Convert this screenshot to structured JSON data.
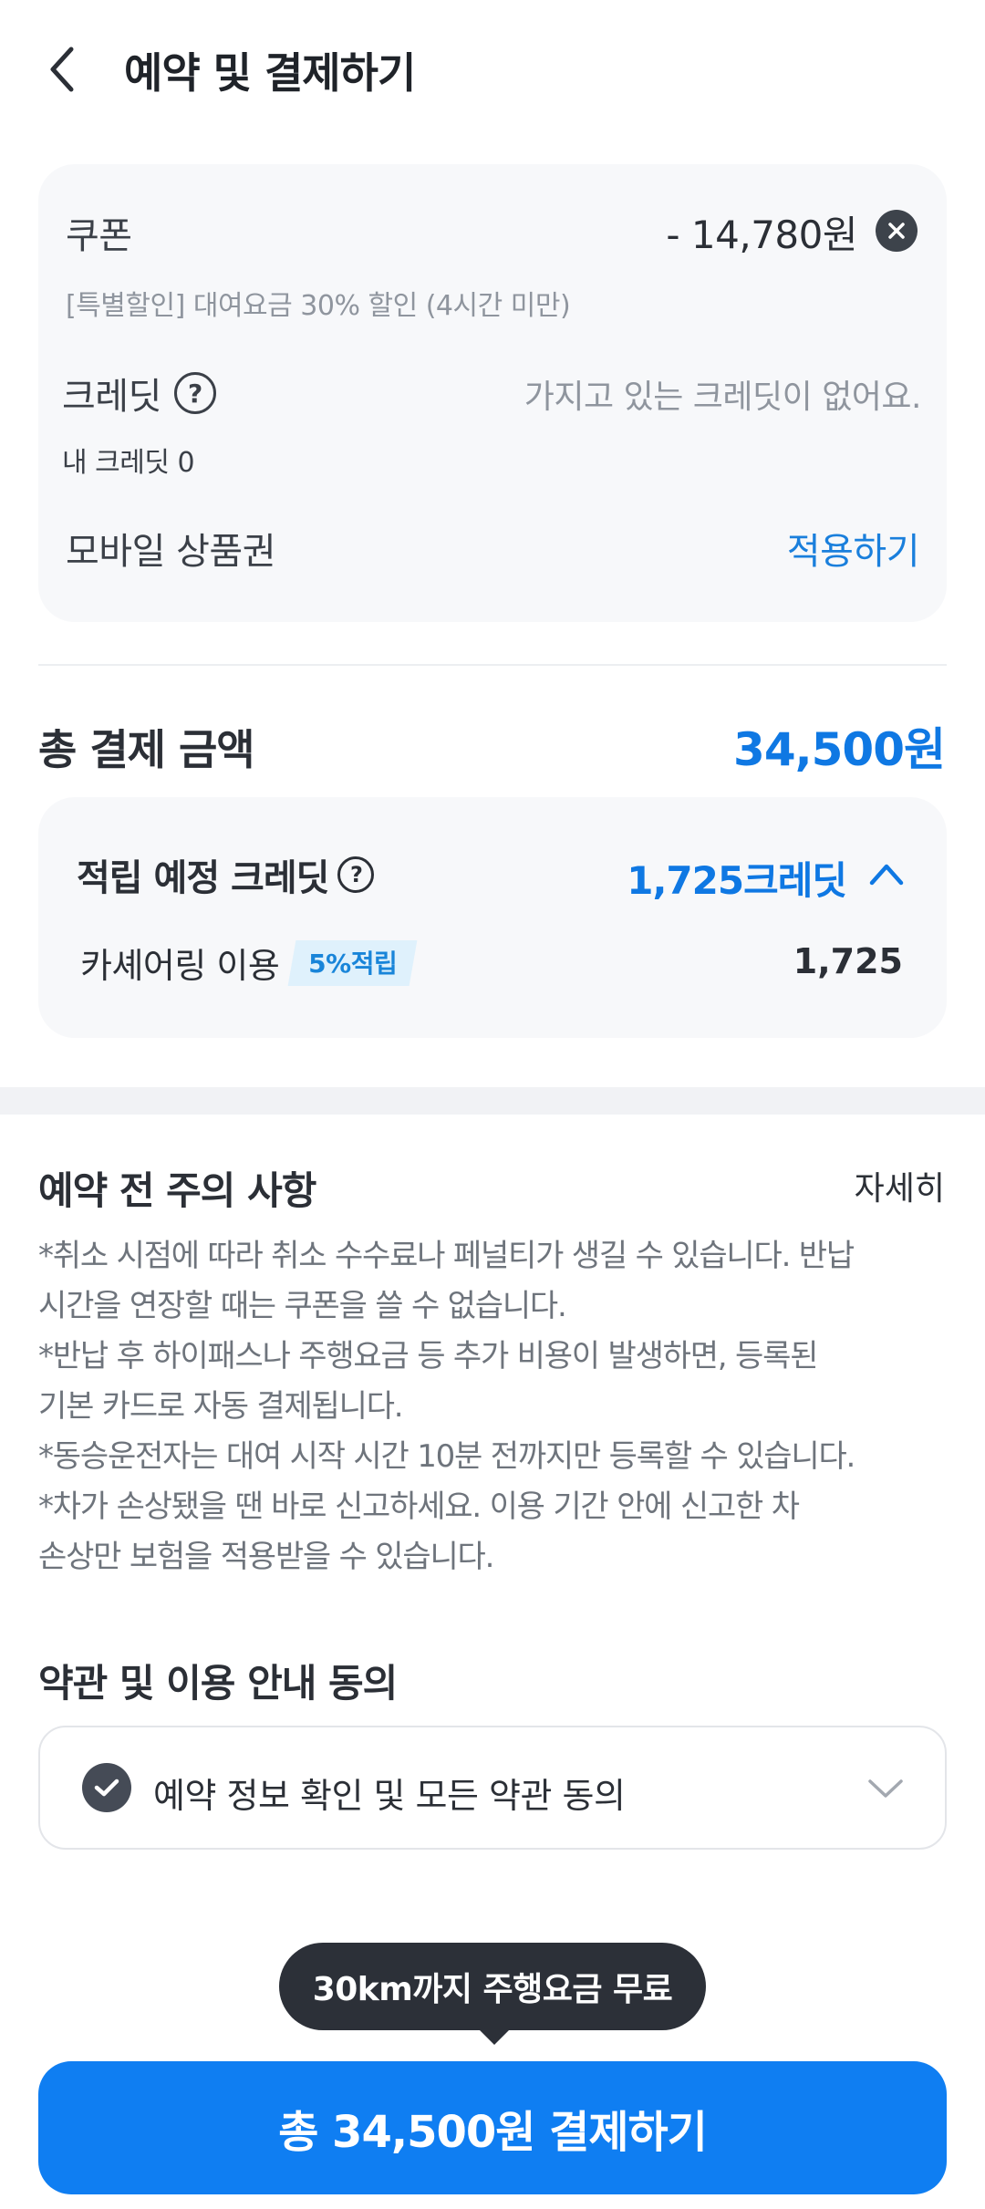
{
  "header": {
    "title": "예약 및 결제하기"
  },
  "discount": {
    "coupon_label": "쿠폰",
    "coupon_amount": "- 14,780원",
    "coupon_desc": "[특별할인] 대여요금 30% 할인 (4시간 미만)",
    "credit_label": "크레딧",
    "credit_help": "?",
    "credit_status": "가지고 있는 크레딧이 없어요.",
    "my_credit": "내 크레딧 0",
    "mobile_label": "모바일 상품권",
    "apply_label": "적용하기"
  },
  "total": {
    "label": "총 결제 금액",
    "amount": "34,500원"
  },
  "earn": {
    "label": "적립 예정 크레딧",
    "help": "?",
    "amount": "1,725크레딧",
    "item_label": "카셰어링 이용",
    "badge": "5%적립",
    "item_value": "1,725"
  },
  "notice": {
    "title": "예약 전 주의 사항",
    "detail": "자세히",
    "lines": [
      "*취소 시점에 따라 취소 수수료나 페널티가 생길 수 있습니다. 반납",
      "시간을 연장할 때는 쿠폰을 쓸 수 없습니다.",
      "*반납 후 하이패스나 주행요금 등 추가 비용이 발생하면, 등록된",
      "기본 카드로 자동 결제됩니다.",
      "*동승운전자는 대여 시작 시간 10분 전까지만 등록할 수 있습니다.",
      "*차가 손상됐을 땐 바로 신고하세요. 이용 기간 안에 신고한 차",
      "손상만 보험을 적용받을 수 있습니다."
    ]
  },
  "terms": {
    "title": "약관 및 이용 안내 동의",
    "label": "예약 정보 확인 및 모든 약관 동의",
    "checked": true
  },
  "tooltip": {
    "text": "30km까지 주행요금 무료"
  },
  "pay_button": {
    "label": "총 34,500원 결제하기"
  },
  "colors": {
    "accent": "#0f7ef2",
    "text_blue": "#0f78e3",
    "card_bg": "#f7f8fa",
    "badge_bg": "#dff1fc"
  },
  "icons": [
    "back-arrow-icon",
    "close-circle-icon",
    "help-icon",
    "chevron-up-icon",
    "check-circle-icon",
    "chevron-down-icon"
  ]
}
